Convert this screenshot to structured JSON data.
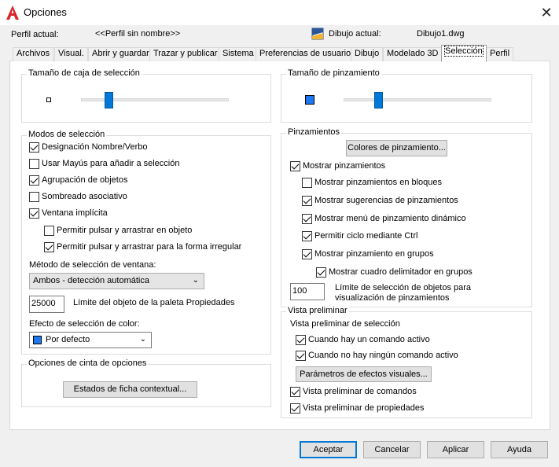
{
  "window": {
    "title": "Opciones",
    "close_glyph": "✕"
  },
  "profile": {
    "current_label": "Perfil actual:",
    "current_value": "<<Perfil sin nombre>>",
    "drawing_label": "Dibujo actual:",
    "drawing_value": "Dibujo1.dwg"
  },
  "tabs": [
    {
      "label": "Archivos"
    },
    {
      "label": "Visual."
    },
    {
      "label": "Abrir y guardar"
    },
    {
      "label": "Trazar y publicar"
    },
    {
      "label": "Sistema"
    },
    {
      "label": "Preferencias de usuario"
    },
    {
      "label": "Dibujo"
    },
    {
      "label": "Modelado 3D"
    },
    {
      "label": "Selección"
    },
    {
      "label": "Perfil"
    }
  ],
  "pickbox": {
    "title": "Tamaño de caja de selección",
    "level": 0.17
  },
  "gripsize": {
    "title": "Tamaño de pinzamiento",
    "level": 0.22
  },
  "selection_modes": {
    "title": "Modos de selección",
    "items": [
      {
        "label": "Designación Nombre/Verbo",
        "checked": true
      },
      {
        "label": "Usar Mayús para añadir a selección",
        "checked": false
      },
      {
        "label": "Agrupación de objetos",
        "checked": true
      },
      {
        "label": "Sombreado asociativo",
        "checked": false
      },
      {
        "label": "Ventana implícita",
        "checked": true
      },
      {
        "label": "Permitir pulsar y arrastrar en objeto",
        "checked": false
      },
      {
        "label": "Permitir pulsar y arrastrar para la forma irregular",
        "checked": true
      }
    ],
    "window_method_label": "Método de selección de ventana:",
    "window_method_value": "Ambos - detección automática",
    "object_limit_value": "25000",
    "object_limit_label": "Límite del objeto de la paleta Propiedades",
    "color_effect_label": "Efecto de selección de color:",
    "color_effect_value": "Por defecto",
    "color_effect_swatch": "#1e78f0"
  },
  "ribbon": {
    "title": "Opciones de cinta de opciones",
    "contextual_button": "Estados de ficha contextual..."
  },
  "grips": {
    "title": "Pinzamientos",
    "colors_button": "Colores de pinzamiento...",
    "items": [
      {
        "label": "Mostrar pinzamientos",
        "checked": true
      },
      {
        "label": "Mostrar pinzamientos en bloques",
        "checked": false
      },
      {
        "label": "Mostrar sugerencias de pinzamientos",
        "checked": true
      },
      {
        "label": "Mostrar menú de pinzamiento dinámico",
        "checked": true
      },
      {
        "label": "Permitir ciclo mediante Ctrl",
        "checked": true
      },
      {
        "label": "Mostrar pinzamiento en grupos",
        "checked": true
      },
      {
        "label": "Mostrar cuadro delimitador en grupos",
        "checked": true
      }
    ],
    "limit_value": "100",
    "limit_label_line1": "Límite de selección de objetos para",
    "limit_label_line2": "visualización de pinzamientos"
  },
  "preview": {
    "title": "Vista preliminar",
    "subtitle": "Vista preliminar de selección",
    "items": [
      {
        "label": "Cuando hay un comando activo",
        "checked": true
      },
      {
        "label": "Cuando no hay ningún comando activo",
        "checked": true
      }
    ],
    "visual_effects_button": "Parámetros de efectos visuales...",
    "command_preview": {
      "label": "Vista preliminar de comandos",
      "checked": true
    },
    "property_preview": {
      "label": "Vista preliminar de propiedades",
      "checked": true
    }
  },
  "footer": {
    "accept": "Aceptar",
    "cancel": "Cancelar",
    "apply": "Aplicar",
    "help": "Ayuda"
  }
}
